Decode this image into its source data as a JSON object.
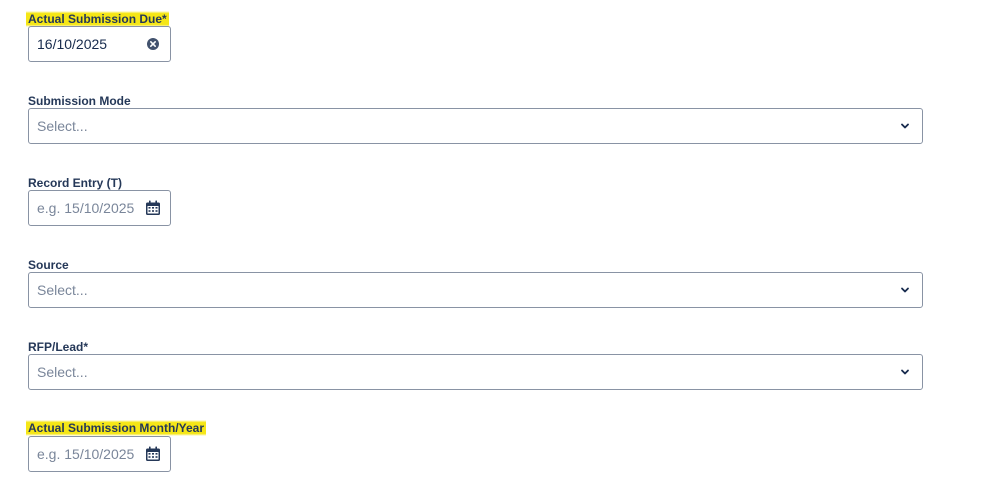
{
  "fields": {
    "actual_submission_due": {
      "label": "Actual Submission Due",
      "required_marker": "*",
      "value": "16/10/2025",
      "clear_icon": "clear-circle-icon"
    },
    "submission_mode": {
      "label": "Submission Mode",
      "placeholder": "Select...",
      "dropdown_icon": "chevron-down-icon"
    },
    "record_entry": {
      "label": "Record Entry (T)",
      "placeholder": "e.g. 15/10/2025",
      "calendar_icon": "calendar-icon"
    },
    "source": {
      "label": "Source",
      "placeholder": "Select...",
      "dropdown_icon": "chevron-down-icon"
    },
    "rfp_lead": {
      "label": "RFP/Lead*",
      "placeholder": "Select...",
      "dropdown_icon": "chevron-down-icon"
    },
    "actual_submission_month_year": {
      "label": "Actual Submission Month/Year",
      "placeholder": "e.g. 15/10/2025",
      "calendar_icon": "calendar-icon"
    }
  },
  "colors": {
    "highlight": "#f5e616",
    "label_text": "#253858",
    "border": "#8993a4",
    "placeholder_text": "#7a869a"
  }
}
